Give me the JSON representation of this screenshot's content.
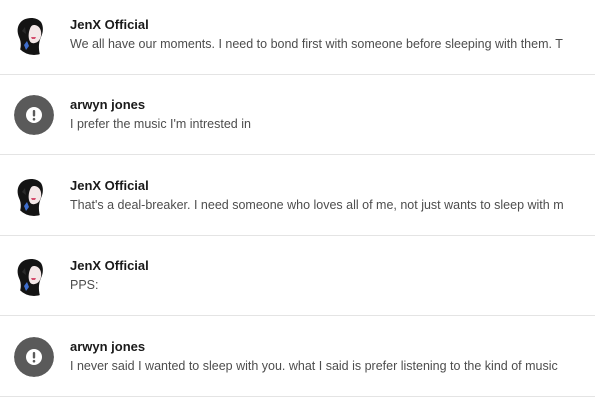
{
  "colors": {
    "divider": "#e4e4e4",
    "author": "#1a1a1a",
    "text": "#4d4d4d",
    "default_avatar_bg": "#5a5a5a"
  },
  "comments": [
    {
      "author": "JenX Official",
      "avatar": "jenx-profile-photo",
      "text": "We all have our moments. I need to bond first with someone before sleeping with them. T"
    },
    {
      "author": "arwyn jones",
      "avatar": "default-alert-avatar-icon",
      "text": "I prefer the music I'm intrested in"
    },
    {
      "author": "JenX Official",
      "avatar": "jenx-profile-photo",
      "text": "That's a deal-breaker. I need someone who loves all of me, not just wants to sleep with m"
    },
    {
      "author": "JenX Official",
      "avatar": "jenx-profile-photo",
      "text": "PPS:"
    },
    {
      "author": "arwyn jones",
      "avatar": "default-alert-avatar-icon",
      "text": "I never said I wanted to sleep with you. what I said is prefer listening to the kind of music"
    }
  ]
}
